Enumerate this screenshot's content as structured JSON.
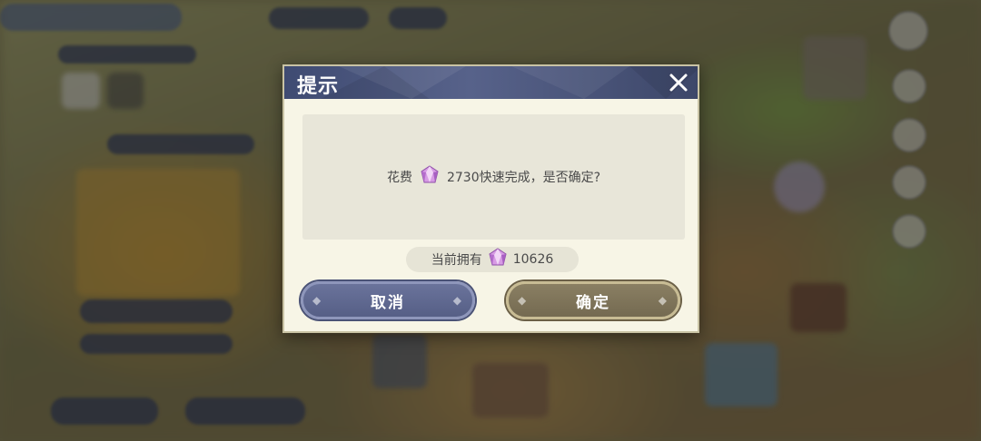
{
  "background": {
    "description_colors": {
      "ground": "#7a6a40",
      "grass": "#6f8a3e",
      "overlay": "#1e1e1e"
    }
  },
  "dialog": {
    "title": "提示",
    "message_prefix": "花费",
    "message_amount_suffix": "2730快速完成，是否确定?",
    "currently_owned_label": "当前拥有",
    "currently_owned_value": "10626",
    "cancel_label": "取消",
    "confirm_label": "确定",
    "icons": {
      "close": "close-icon",
      "currency": "diamond-gem-icon"
    },
    "colors": {
      "header": "#4a5579",
      "body": "#f7f5e6",
      "cancel": "#5f688f",
      "confirm": "#7d7359",
      "gem": "#c98ad8"
    }
  }
}
